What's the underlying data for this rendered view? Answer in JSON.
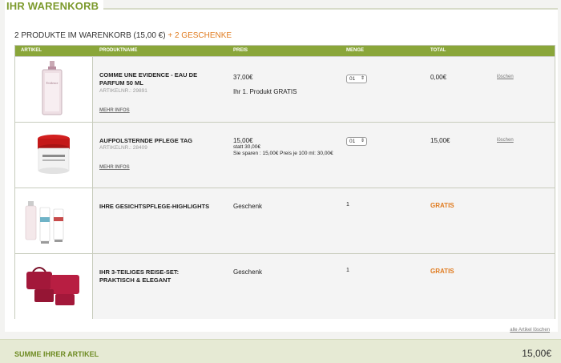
{
  "cart": {
    "title": "IHR WARENKORB",
    "summary_main": "2 PRODUKTE IM WARENKORB (15,00 €)",
    "summary_gifts": "+ 2 GESCHENKE",
    "delete_all": "alle Artikel löschen"
  },
  "table": {
    "headers": [
      "ARTIKEL",
      "PRODUKTNAME",
      "PREIS",
      "MENGE",
      "TOTAL"
    ],
    "rows": [
      {
        "name": "COMME UNE EVIDENCE - EAU DE PARFUM 50 ML",
        "artnr": "ARTIKELNR.: 29891",
        "more": "MEHR INFOS",
        "price": "37,00€",
        "price_note": "Ihr 1. Produkt GRATIS",
        "qty": "01",
        "total": "0,00€",
        "delete": "löschen"
      },
      {
        "name": "AUFPOLSTERNDE PFLEGE TAG",
        "artnr": "ARTIKELNR.: 28409",
        "more": "MEHR INFOS",
        "price": "15,00€",
        "price_old": "statt 30,00€",
        "price_save": "Sie sparen : 15,00€ Preis je 100 ml: 30,00€",
        "qty": "01",
        "total": "15,00€",
        "delete": "löschen"
      },
      {
        "name": "IHRE GESICHTSPFLEGE-HIGHLIGHTS",
        "price": "Geschenk",
        "qty": "1",
        "total": "GRATIS"
      },
      {
        "name": "IHR 3-TEILIGES REISE-SET: PRAKTISCH & ELEGANT",
        "price": "Geschenk",
        "qty": "1",
        "total": "GRATIS"
      }
    ]
  },
  "footer": {
    "label": "SUMME IHRER ARTIKEL",
    "value": "15,00€"
  },
  "colors": {
    "accent_green": "#8aa63a",
    "title_green": "#7c9a2c",
    "gift_orange": "#e07b1f"
  },
  "icons": {
    "select_arrow": "updown-arrow-icon"
  }
}
